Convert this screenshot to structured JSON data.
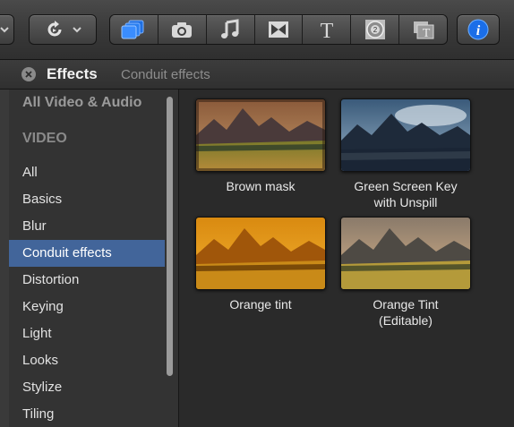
{
  "toolbar": {
    "icons": [
      "arrow-icon",
      "rotate-icon",
      "effects-icon",
      "photo-icon",
      "music-icon",
      "transitions-icon",
      "titles-icon",
      "generators-icon",
      "themes-icon",
      "info-icon"
    ]
  },
  "panel": {
    "title": "Effects",
    "subtitle": "Conduit effects"
  },
  "sidebar": {
    "items": [
      {
        "label": "All Video & Audio",
        "kind": "header"
      },
      {
        "label": "VIDEO",
        "kind": "header"
      },
      {
        "label": "All",
        "kind": "item"
      },
      {
        "label": "Basics",
        "kind": "item"
      },
      {
        "label": "Blur",
        "kind": "item"
      },
      {
        "label": "Conduit effects",
        "kind": "item",
        "selected": true
      },
      {
        "label": "Distortion",
        "kind": "item"
      },
      {
        "label": "Keying",
        "kind": "item"
      },
      {
        "label": "Light",
        "kind": "item"
      },
      {
        "label": "Looks",
        "kind": "item"
      },
      {
        "label": "Stylize",
        "kind": "item"
      },
      {
        "label": "Tiling",
        "kind": "item"
      }
    ]
  },
  "effects": [
    {
      "line1": "Brown mask",
      "line2": "",
      "tint": "brown"
    },
    {
      "line1": "Green Screen Key",
      "line2": "with Unspill",
      "tint": "blue"
    },
    {
      "line1": "Orange tint",
      "line2": "",
      "tint": "orange"
    },
    {
      "line1": "Orange Tint",
      "line2": "(Editable)",
      "tint": "natural"
    }
  ],
  "colors": {
    "selection": "#42659a",
    "accent": "#1f6fe0"
  }
}
